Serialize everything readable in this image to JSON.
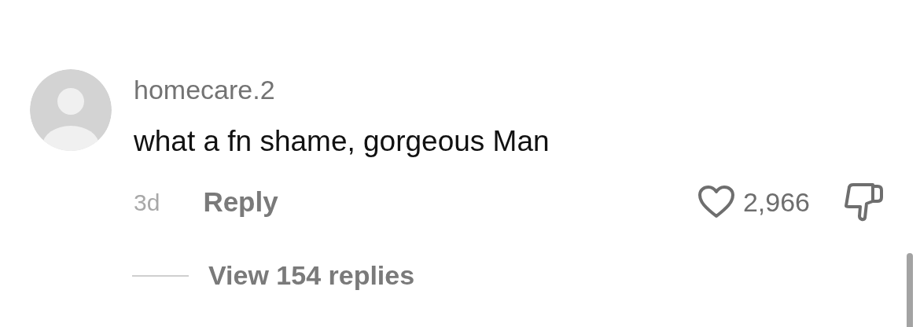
{
  "comment": {
    "username": "homecare.2",
    "text": "what a fn shame, gorgeous Man",
    "age": "3d",
    "reply_label": "Reply",
    "likes": "2,966",
    "liked": false,
    "disliked": false,
    "view_replies": "View 154 replies"
  }
}
